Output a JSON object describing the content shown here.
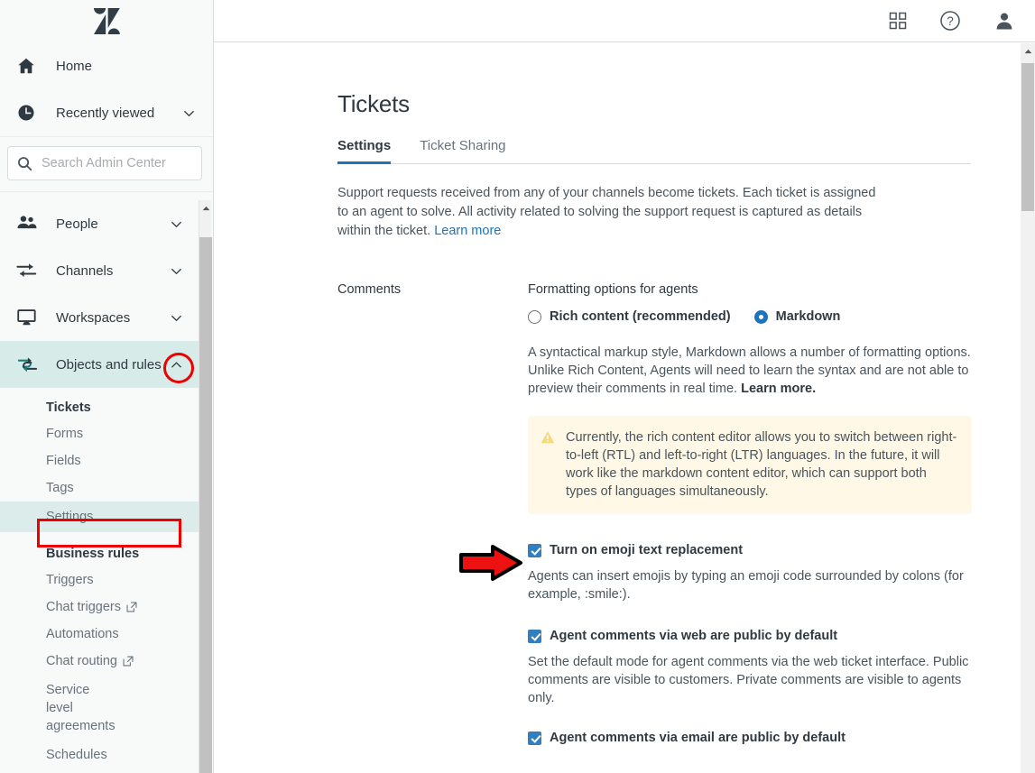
{
  "app": {
    "name": "Zendesk Admin Center",
    "logo_icon": "zendesk-logo"
  },
  "sidebar": {
    "search": {
      "placeholder": "Search Admin Center",
      "value": "",
      "icon": "search-icon"
    },
    "top_items": [
      {
        "label": "Home",
        "icon": "home-icon",
        "expandable": false
      },
      {
        "label": "Recently viewed",
        "icon": "clock-icon",
        "expandable": true,
        "chevron": "chevron-down-icon"
      }
    ],
    "nav_items": [
      {
        "label": "People",
        "icon": "people-icon",
        "chevron": "chevron-down-icon",
        "active": false
      },
      {
        "label": "Channels",
        "icon": "channels-icon",
        "chevron": "chevron-down-icon",
        "active": false
      },
      {
        "label": "Workspaces",
        "icon": "workspaces-icon",
        "chevron": "chevron-down-icon",
        "active": false
      },
      {
        "label": "Objects and rules",
        "icon": "objects-rules-icon",
        "chevron": "chevron-up-icon",
        "active": true
      }
    ],
    "sub_groups": [
      {
        "heading": "Tickets",
        "items": [
          {
            "label": "Forms",
            "external": false,
            "highlighted": false
          },
          {
            "label": "Fields",
            "external": false,
            "highlighted": false
          },
          {
            "label": "Tags",
            "external": false,
            "highlighted": false
          },
          {
            "label": "Settings",
            "external": false,
            "highlighted": true
          }
        ]
      },
      {
        "heading": "Business rules",
        "items": [
          {
            "label": "Triggers",
            "external": false,
            "highlighted": false
          },
          {
            "label": "Chat triggers",
            "external": true,
            "highlighted": false
          },
          {
            "label": "Automations",
            "external": false,
            "highlighted": false
          },
          {
            "label": "Chat routing",
            "external": true,
            "highlighted": false
          },
          {
            "label": "Service level agreements",
            "external": false,
            "highlighted": false
          },
          {
            "label": "Schedules",
            "external": false,
            "highlighted": false
          }
        ]
      }
    ]
  },
  "topbar": {
    "icons": [
      {
        "name": "products-grid-icon"
      },
      {
        "name": "help-icon"
      },
      {
        "name": "user-avatar-icon"
      }
    ]
  },
  "main": {
    "page_title": "Tickets",
    "tabs": [
      {
        "label": "Settings",
        "active": true
      },
      {
        "label": "Ticket Sharing",
        "active": false
      }
    ],
    "intro": {
      "text": "Support requests received from any of your channels become tickets. Each ticket is assigned to an agent to solve. All activity related to solving the support request is captured as details within the ticket. ",
      "link": "Learn more"
    },
    "comments_section": {
      "label": "Comments",
      "formatting_label": "Formatting options for agents",
      "radios": [
        {
          "label": "Rich content (recommended)",
          "checked": false
        },
        {
          "label": "Markdown",
          "checked": true
        }
      ],
      "markdown_help_part1": "A syntactical markup style, Markdown allows a number of formatting options. Unlike Rich Content, Agents will need to learn the syntax and are not able to preview their comments in real time. ",
      "markdown_help_link": "Learn more.",
      "alert": {
        "icon": "warning-triangle-icon",
        "text": "Currently, the rich content editor allows you to switch between right-to-left (RTL) and left-to-right (LTR) languages. In the future, it will work like the markdown content editor, which can support both types of languages simultaneously."
      },
      "checkboxes": [
        {
          "label": "Turn on emoji text replacement",
          "checked": true,
          "description": "Agents can insert emojis by typing an emoji code surrounded by colons (for example, :smile:)."
        },
        {
          "label": "Agent comments via web are public by default",
          "checked": true,
          "description": "Set the default mode for agent comments via the web ticket interface. Public comments are visible to customers. Private comments are visible to agents only."
        },
        {
          "label": "Agent comments via email are public by default",
          "checked": true,
          "description": ""
        }
      ]
    }
  },
  "annotations": [
    {
      "name": "red-circle-annotation",
      "target": "objects-and-rules-chevron",
      "color": "#ee0000"
    },
    {
      "name": "red-rectangle-annotation",
      "target": "sidebar-item-settings",
      "color": "#ee0000"
    },
    {
      "name": "red-arrow-annotation",
      "target": "emoji-checkbox",
      "color": "#ee0000"
    }
  ],
  "scrollbars": {
    "sidebar": {
      "arrow_icon": "scroll-up-arrow-icon"
    },
    "main": {
      "arrow_icon": "scroll-up-arrow-icon"
    }
  },
  "colors": {
    "accent_teal": "#d7ebe8",
    "tab_underline": "#1f73b7",
    "link": "#1f73b7",
    "checkbox_blue": "#337fbd",
    "alert_bg": "#fff8e6",
    "annotation_red": "#ee0000"
  }
}
